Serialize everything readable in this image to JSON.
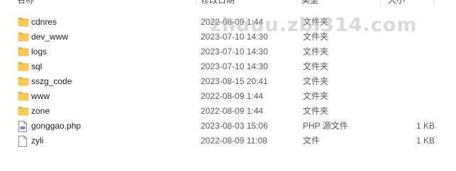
{
  "columns": {
    "name": "名称",
    "date": "修改日期",
    "type": "类型",
    "size": "大小"
  },
  "files": [
    {
      "icon": "folder-icon",
      "name": "cdnres",
      "date": "2022-08-09 1:44",
      "type": "文件夹",
      "size": ""
    },
    {
      "icon": "folder-icon",
      "name": "dev_www",
      "date": "2023-07-10 14:30",
      "type": "文件夹",
      "size": ""
    },
    {
      "icon": "folder-icon",
      "name": "logs",
      "date": "2023-07-10 14:30",
      "type": "文件夹",
      "size": ""
    },
    {
      "icon": "folder-icon",
      "name": "sql",
      "date": "2023-07-10 14:30",
      "type": "文件夹",
      "size": ""
    },
    {
      "icon": "folder-icon",
      "name": "sszg_code",
      "date": "2023-08-15 20:41",
      "type": "文件夹",
      "size": ""
    },
    {
      "icon": "folder-icon",
      "name": "www",
      "date": "2022-08-09 1:44",
      "type": "文件夹",
      "size": ""
    },
    {
      "icon": "folder-icon",
      "name": "zone",
      "date": "2022-08-09 1:44",
      "type": "文件夹",
      "size": ""
    },
    {
      "icon": "php-file-icon",
      "name": "gonggao.php",
      "date": "2023-08-03 15:06",
      "type": "PHP 源文件",
      "size": "1 KB"
    },
    {
      "icon": "blank-file-icon",
      "name": "zyli",
      "date": "2022-08-09 11:08",
      "type": "文件",
      "size": "1 KB"
    }
  ],
  "watermark": "zhuuu.zbl314.com",
  "colors": {
    "folder": "#f8c95a",
    "folder_dark": "#e9b444",
    "php_accent": "#8a7fd0"
  }
}
